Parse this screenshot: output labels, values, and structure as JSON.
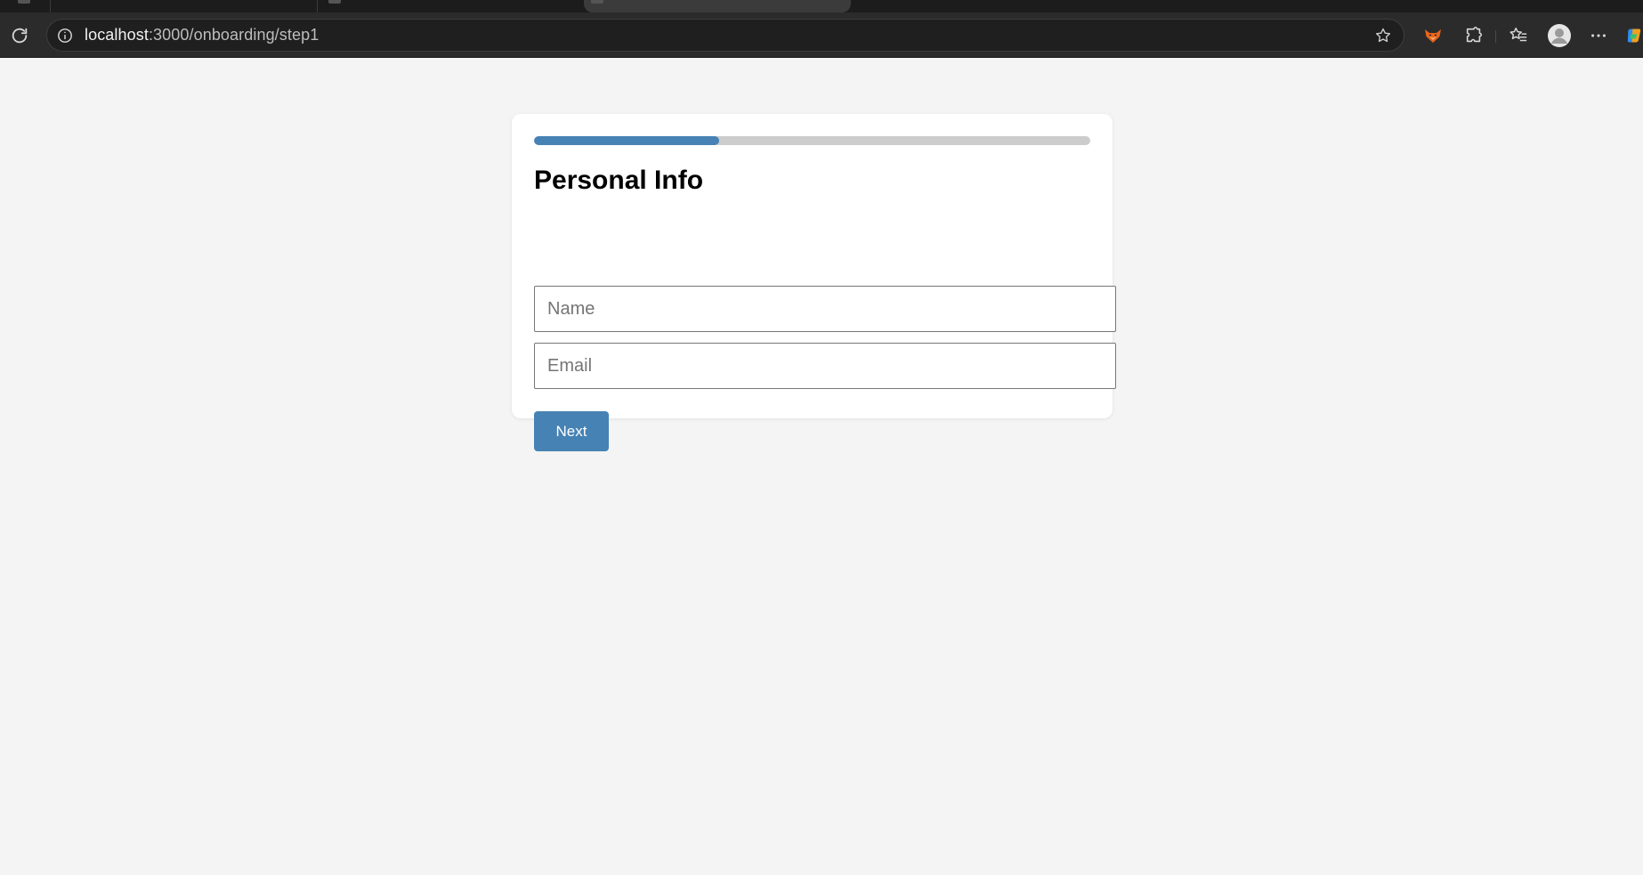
{
  "browser": {
    "url_host": "localhost",
    "url_path": ":3000/onboarding/step1"
  },
  "icons": {
    "reload": "reload-icon",
    "site_info": "info-icon",
    "favorite": "star-icon",
    "extension_fox": "fox-extension-icon",
    "extensions": "puzzle-icon",
    "favorites": "favorites-icon",
    "profile": "profile-icon",
    "menu": "more-icon",
    "copilot": "copilot-icon"
  },
  "colors": {
    "accent": "#4682b4",
    "track": "#cccccc",
    "background": "#f4f4f4"
  },
  "onboarding": {
    "progress_fraction": 0.333,
    "title": "Personal Info",
    "name_placeholder": "Name",
    "name_value": "",
    "email_placeholder": "Email",
    "email_value": "",
    "next_label": "Next"
  }
}
